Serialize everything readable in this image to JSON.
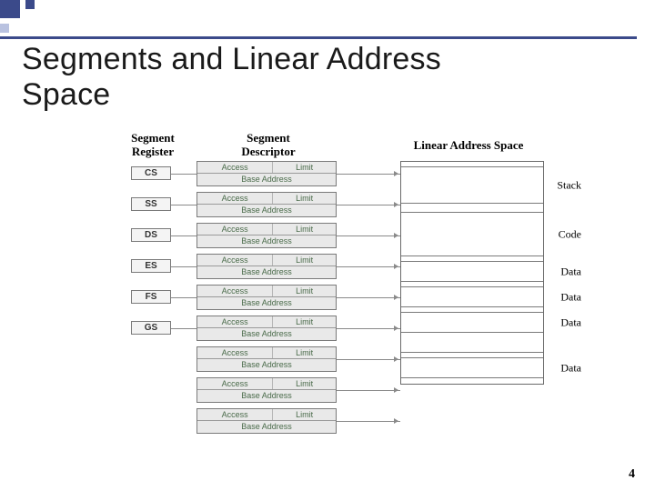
{
  "title": "Segments and Linear Address\nSpace",
  "headers": {
    "register": "Segment\nRegister",
    "descriptor": "Segment\nDescriptor",
    "linear": "Linear Address Space"
  },
  "registers": [
    "CS",
    "SS",
    "DS",
    "ES",
    "FS",
    "GS"
  ],
  "descriptor_fields": {
    "access": "Access",
    "limit": "Limit",
    "base": "Base Address"
  },
  "segments": [
    {
      "label": "",
      "size": "thin"
    },
    {
      "label": "Stack",
      "size": "med"
    },
    {
      "label": "",
      "size": "tiny"
    },
    {
      "label": "Code",
      "size": "big"
    },
    {
      "label": "",
      "size": "thin"
    },
    {
      "label": "Data",
      "size": "small"
    },
    {
      "label": "",
      "size": "thin"
    },
    {
      "label": "Data",
      "size": "small"
    },
    {
      "label": "",
      "size": "thin"
    },
    {
      "label": "Data",
      "size": "small"
    },
    {
      "label": "",
      "size": "small"
    },
    {
      "label": "",
      "size": "thin"
    },
    {
      "label": "Data",
      "size": "small"
    },
    {
      "label": "",
      "size": "thin"
    }
  ],
  "page_number": "4"
}
